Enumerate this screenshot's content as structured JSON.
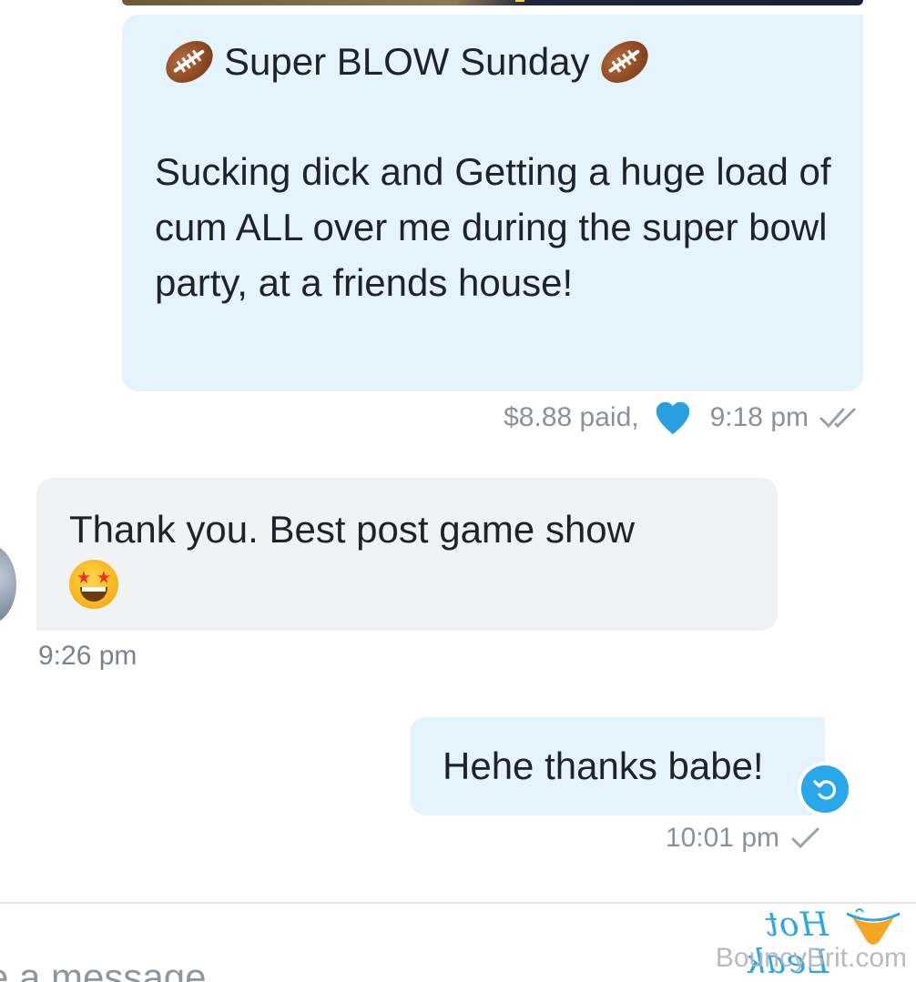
{
  "messages": [
    {
      "direction": "outgoing",
      "title": "Super BLOW Sunday",
      "body": "Sucking dick and Getting a huge load of cum ALL over me during the super bowl party, at a friends house!",
      "paid_label": "$8.88 paid,",
      "time": "9:18 pm",
      "status": "read"
    },
    {
      "direction": "incoming",
      "body": "Thank you. Best post game show",
      "emoji": "star-struck",
      "time": "9:26 pm"
    },
    {
      "direction": "outgoing",
      "body": "Hehe thanks babe!",
      "time": "10:01 pm",
      "status": "sent"
    }
  ],
  "composer": {
    "placeholder": "e a message"
  },
  "watermark": {
    "script": "Hot Leak",
    "site": "BouncyBrit.com"
  },
  "colors": {
    "outgoing_bubble": "#e5f3fc",
    "incoming_bubble": "#f1f2f4",
    "accent": "#29a8e9",
    "meta_text": "#8a9199"
  },
  "icons": [
    "football-icon",
    "heart-icon",
    "double-check-icon",
    "star-struck-emoji-icon",
    "undo-icon",
    "check-icon"
  ]
}
